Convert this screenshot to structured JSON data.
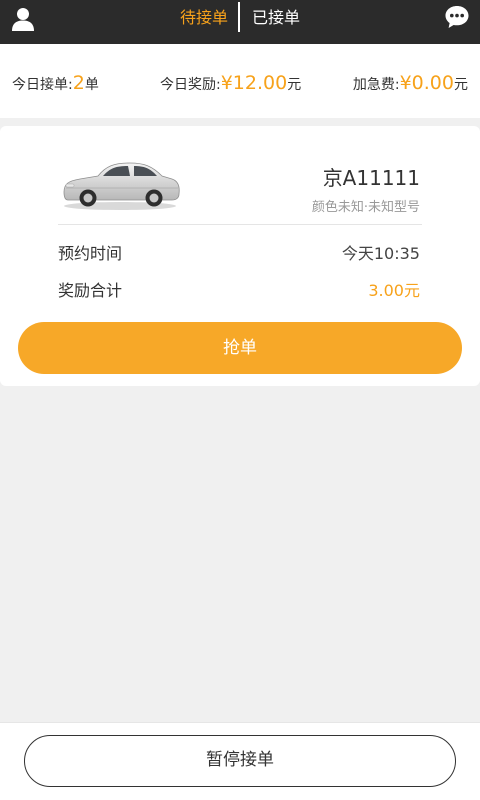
{
  "header": {
    "tabs": [
      {
        "label": "待接单",
        "active": true
      },
      {
        "label": "已接单",
        "active": false
      }
    ],
    "icons": {
      "left": "user-icon",
      "right": "chat-bubble-icon"
    },
    "accent_color": "#f7a21b"
  },
  "stats": {
    "orders": {
      "label": "今日接单:",
      "value": "2",
      "unit": "单"
    },
    "reward": {
      "label": "今日奖励:",
      "value": "¥12.00",
      "unit": "元"
    },
    "urgent": {
      "label": "加急费:",
      "value": "¥0.00",
      "unit": "元"
    }
  },
  "order": {
    "plate": "京A11111",
    "car_desc": "颜色未知·未知型号",
    "rows": [
      {
        "label": "预约时间",
        "value": "今天10:35"
      },
      {
        "label": "奖励合计",
        "value": "3.00元"
      }
    ],
    "grab_label": "抢单"
  },
  "footer": {
    "pause_label": "暂停接单"
  }
}
